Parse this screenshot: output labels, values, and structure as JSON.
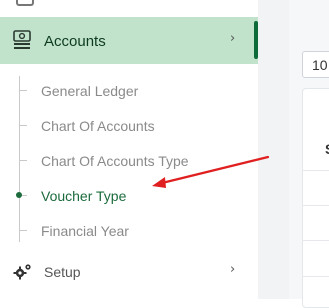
{
  "sidebar": {
    "accounts": {
      "label": "Accounts",
      "icon": "money-stack-icon",
      "chevron": "›",
      "children": [
        {
          "label": "General Ledger"
        },
        {
          "label": "Chart Of Accounts"
        },
        {
          "label": "Chart Of Accounts Type"
        },
        {
          "label": "Voucher Type",
          "active": true
        },
        {
          "label": "Financial Year"
        }
      ]
    },
    "setup": {
      "label": "Setup",
      "icon": "gears-icon",
      "chevron": "›"
    }
  },
  "main": {
    "page_size_value": "10",
    "table_header_fragment": "S"
  },
  "colors": {
    "active_bg": "#c1e3cc",
    "active_accent": "#0d6b3a",
    "active_text": "#1c6b3d",
    "arrow": "#e02020"
  }
}
